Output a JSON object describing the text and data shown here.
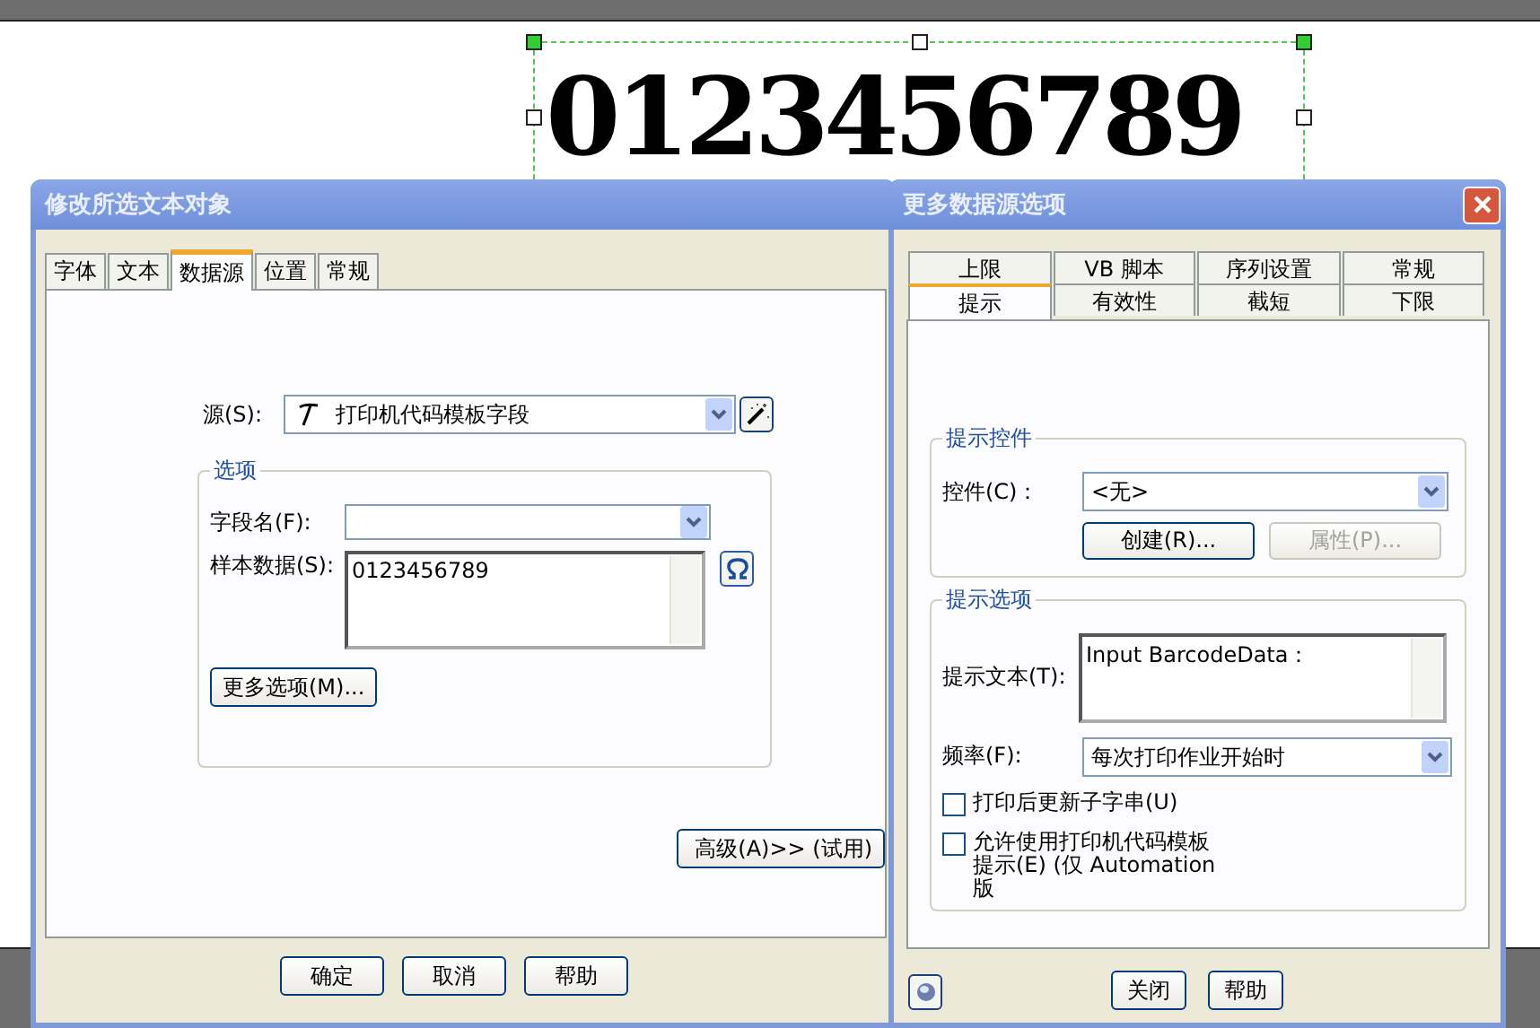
{
  "canvas": {
    "barcode_text": "0123456789"
  },
  "left_dialog": {
    "title": "修改所选文本对象",
    "tabs": [
      {
        "label": "字体",
        "selected": false
      },
      {
        "label": "文本",
        "selected": false
      },
      {
        "label": "数据源",
        "selected": true
      },
      {
        "label": "位置",
        "selected": false
      },
      {
        "label": "常规",
        "selected": false
      }
    ],
    "source": {
      "label": "源(S):",
      "value": "打印机代码模板字段"
    },
    "options_group": {
      "title": "选项",
      "field_name_label": "字段名(F):",
      "sample_label": "样本数据(S):",
      "sample_value": "0123456789",
      "more_button": "更多选项(M)..."
    },
    "advanced_button": "高级(A)>> (试用)",
    "buttons": [
      "确定",
      "取消",
      "帮助"
    ]
  },
  "right_dialog": {
    "title": "更多数据源选项",
    "tab_rows": [
      [
        {
          "label": "上限",
          "selected": false
        },
        {
          "label": "VB 脚本",
          "selected": false
        },
        {
          "label": "序列设置",
          "selected": false
        },
        {
          "label": "常规",
          "selected": false
        }
      ],
      [
        {
          "label": "提示",
          "selected": true
        },
        {
          "label": "有效性",
          "selected": false
        },
        {
          "label": "截短",
          "selected": false
        },
        {
          "label": "下限",
          "selected": false
        }
      ]
    ],
    "prompt_control": {
      "title": "提示控件",
      "control_label": "控件(C)：",
      "control_value": "<无>",
      "buttons": [
        {
          "label": "创建(R)...",
          "disabled": false
        },
        {
          "label": "属性(P)...",
          "disabled": true
        }
      ]
    },
    "prompt_options": {
      "title": "提示选项",
      "text_label": "提示文本(T):",
      "text_value": "Input BarcodeData：",
      "frequency_label": "频率(F):",
      "frequency_value": "每次打印作业开始时",
      "checkboxes": [
        {
          "label": "打印后更新子字串(U)",
          "checked": false
        },
        {
          "label": "允许使用打印机代码模板提示(E) (仅 Automation 版",
          "checked": false
        }
      ]
    },
    "buttons": [
      "关闭",
      "帮助"
    ]
  }
}
